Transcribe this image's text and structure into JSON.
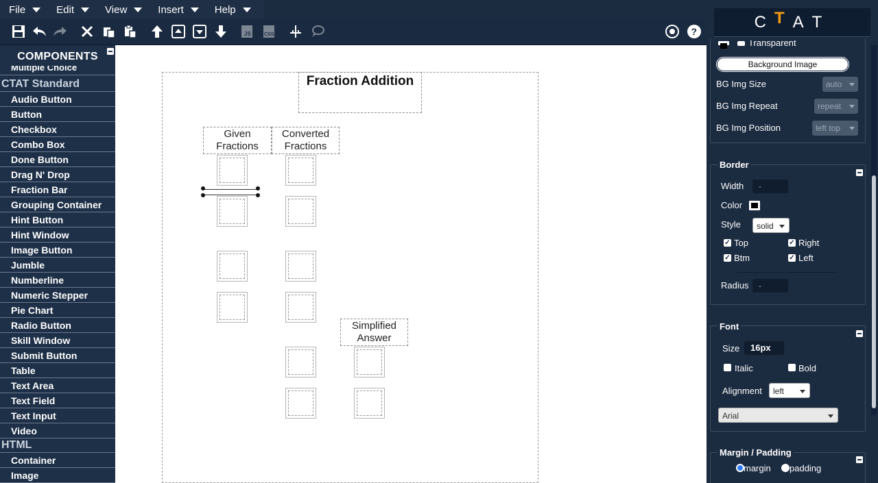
{
  "menu": {
    "file": "File",
    "edit": "Edit",
    "view": "View",
    "insert": "Insert",
    "help": "Help"
  },
  "logo": {
    "c": "C",
    "t": "T",
    "a": "A",
    "t2": "T"
  },
  "components": {
    "heading": "COMPONENTS",
    "partial_top": "Multiple Choice",
    "category_ctat": "CTAT Standard",
    "items": [
      "Audio Button",
      "Button",
      "Checkbox",
      "Combo Box",
      "Done Button",
      "Drag N' Drop",
      "Fraction Bar",
      "Grouping Container",
      "Hint Button",
      "Hint Window",
      "Image Button",
      "Jumble",
      "Numberline",
      "Numeric Stepper",
      "Pie Chart",
      "Radio Button",
      "Skill Window",
      "Submit Button",
      "Table",
      "Text Area",
      "Text Field",
      "Text Input",
      "Video"
    ],
    "category_html": "HTML",
    "html_items": [
      "Container",
      "Image"
    ]
  },
  "canvas": {
    "title": "Fraction Addition",
    "given_label": "Given Fractions",
    "converted_label": "Converted Fractions",
    "simplified_label": "Simplified Answer"
  },
  "properties": {
    "transparent_label": "Transparent",
    "bg_image_button": "Background Image",
    "bg_img_size_label": "BG Img Size",
    "bg_img_size_value": "auto",
    "bg_img_repeat_label": "BG Img Repeat",
    "bg_img_repeat_value": "repeat",
    "bg_img_position_label": "BG Img Position",
    "bg_img_position_value": "left top",
    "border": {
      "title": "Border",
      "width_label": "Width",
      "width_value": "-",
      "color_label": "Color",
      "style_label": "Style",
      "style_value": "solid",
      "top": "Top",
      "right": "Right",
      "btm": "Btm",
      "left": "Left",
      "radius_label": "Radius",
      "radius_value": "-"
    },
    "font": {
      "title": "Font",
      "size_label": "Size",
      "size_value": "16px",
      "italic": "Italic",
      "bold": "Bold",
      "alignment_label": "Alignment",
      "alignment_value": "left",
      "family_value": "Arial"
    },
    "margin": {
      "title": "Margin / Padding",
      "margin": "margin",
      "padding": "padding"
    }
  },
  "colors": {
    "accent": "#f39c12",
    "panel": "#1e3048",
    "radio_on": "#2f7cf6"
  }
}
